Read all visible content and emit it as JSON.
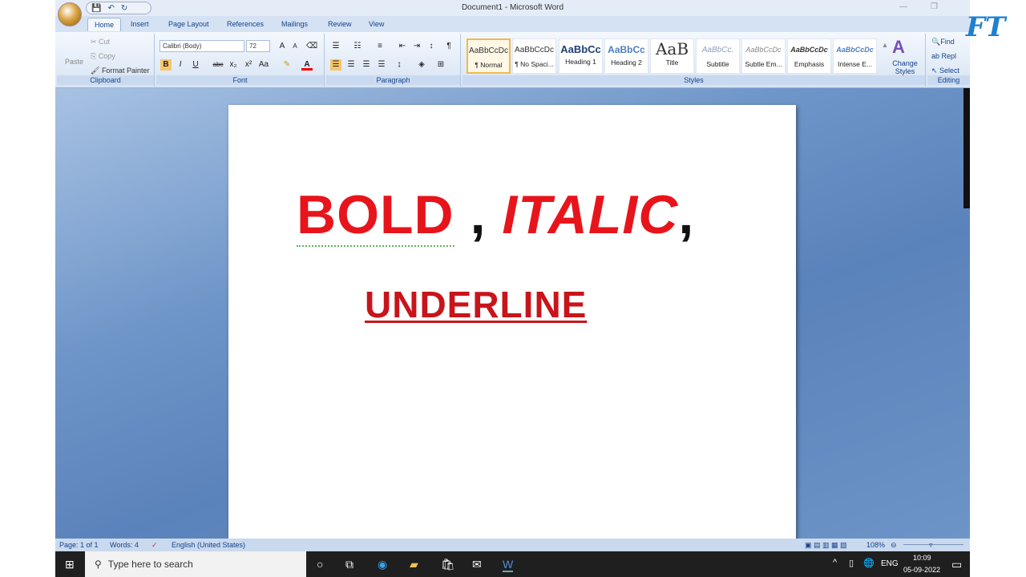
{
  "window": {
    "title": "Document1 - Microsoft Word"
  },
  "tabs": [
    "Home",
    "Insert",
    "Page Layout",
    "References",
    "Mailings",
    "Review",
    "View"
  ],
  "clipboard": {
    "paste": "Paste",
    "cut": "Cut",
    "copy": "Copy",
    "format_painter": "Format Painter",
    "label": "Clipboard"
  },
  "font": {
    "name": "Calibri (Body)",
    "size": "72",
    "label": "Font"
  },
  "paragraph": {
    "label": "Paragraph"
  },
  "styles": {
    "label": "Styles",
    "items": [
      {
        "preview": "AaBbCcDc",
        "name": "¶ Normal"
      },
      {
        "preview": "AaBbCcDc",
        "name": "¶ No Spaci..."
      },
      {
        "preview": "AaBbCc",
        "name": "Heading 1"
      },
      {
        "preview": "AaBbCc",
        "name": "Heading 2"
      },
      {
        "preview": "AaB",
        "name": "Title"
      },
      {
        "preview": "AaBbCc.",
        "name": "Subtitle"
      },
      {
        "preview": "AaBbCcDc",
        "name": "Subtle Em..."
      },
      {
        "preview": "AaBbCcDc",
        "name": "Emphasis"
      },
      {
        "preview": "AaBbCcDc",
        "name": "Intense E..."
      }
    ],
    "change": "Change Styles"
  },
  "editing": {
    "find": "Find",
    "replace": "Repl",
    "select": "Select",
    "label": "Editing"
  },
  "document": {
    "word1": "BOLD",
    "sep1": ",",
    "word2": "ITALIC",
    "sep2": ",",
    "line2": "UNDERLINE"
  },
  "status": {
    "page": "Page: 1 of 1",
    "words": "Words: 4",
    "language": "English (United States)",
    "zoom": "108%"
  },
  "taskbar": {
    "search_placeholder": "Type here to search",
    "lang": "ENG",
    "time": "10:09",
    "date": "05-09-2022"
  },
  "logo": {
    "text": "FT"
  }
}
